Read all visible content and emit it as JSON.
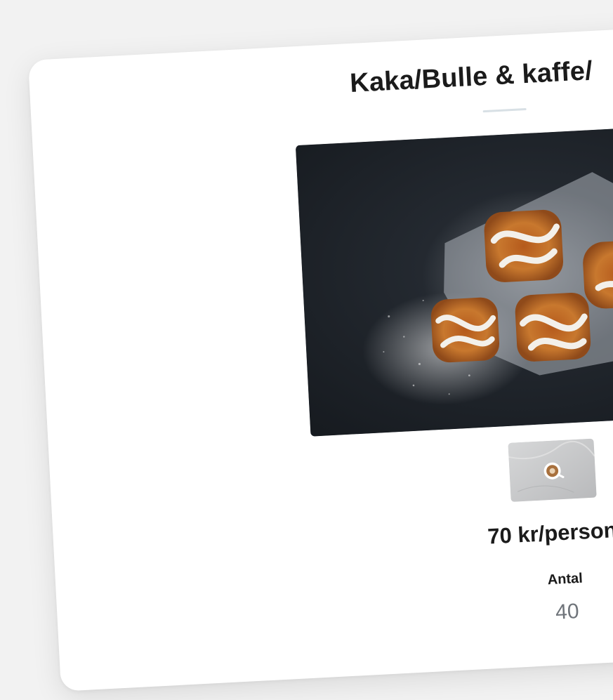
{
  "product": {
    "title": "Kaka/Bulle & kaffe/",
    "price": "70 kr/person",
    "quantity_label": "Antal",
    "quantity_value": "40"
  },
  "images": {
    "main": "cinnamon-buns-photo",
    "thumbnail": "coffee-cup-photo"
  },
  "colors": {
    "background": "#f2f2f2",
    "card": "#ffffff",
    "text": "#1b1b1b",
    "muted_text": "#6f747a",
    "divider": "#d8e0e5"
  }
}
